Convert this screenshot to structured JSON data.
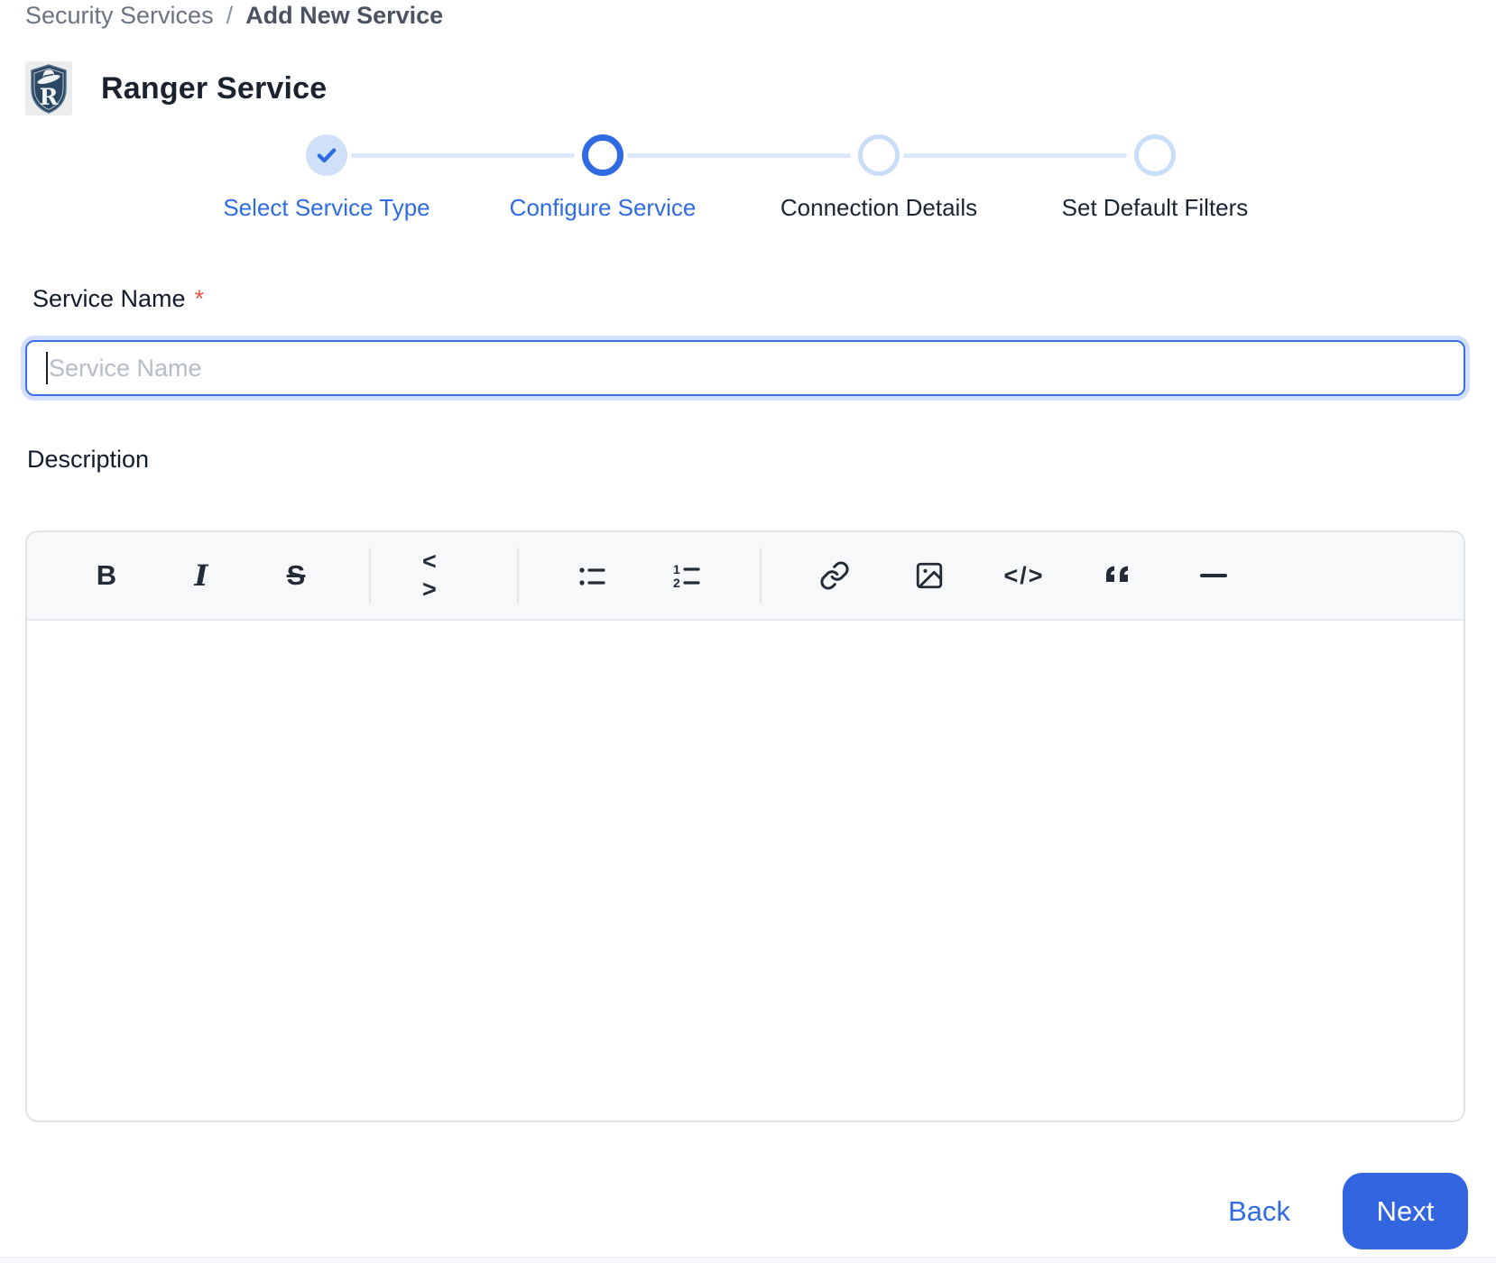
{
  "breadcrumb": {
    "items": [
      "Security Services",
      "Add New Service"
    ],
    "separator": "/"
  },
  "header": {
    "title": "Ranger Service",
    "logo_icon": "ranger-shield-logo"
  },
  "stepper": {
    "steps": [
      {
        "label": "Select Service Type",
        "state": "completed"
      },
      {
        "label": "Configure Service",
        "state": "active"
      },
      {
        "label": "Connection Details",
        "state": "pending"
      },
      {
        "label": "Set Default Filters",
        "state": "pending"
      }
    ]
  },
  "form": {
    "service_name": {
      "label": "Service Name",
      "required_marker": "*",
      "placeholder": "Service Name",
      "value": ""
    },
    "description": {
      "label": "Description",
      "value": ""
    }
  },
  "toolbar": {
    "button_icons": [
      "bold-icon",
      "italic-icon",
      "strikethrough-icon",
      "inline-code-icon",
      "bulleted-list-icon",
      "numbered-list-icon",
      "link-icon",
      "image-icon",
      "code-block-icon",
      "blockquote-icon",
      "horizontal-rule-icon"
    ],
    "glyphs": {
      "bold": "B",
      "italic": "I",
      "strikethrough": "S",
      "inline_code": "< >",
      "code_block": "</>"
    }
  },
  "footer": {
    "back_label": "Back",
    "next_label": "Next"
  },
  "colors": {
    "accent_blue": "#2F6BE2",
    "button_blue": "#3465E0",
    "step_completed_fill": "#CFE0F8",
    "connector_blue": "#DBE7FA",
    "required_red": "#E4574E",
    "toolbar_bg": "#F7F8FA"
  }
}
